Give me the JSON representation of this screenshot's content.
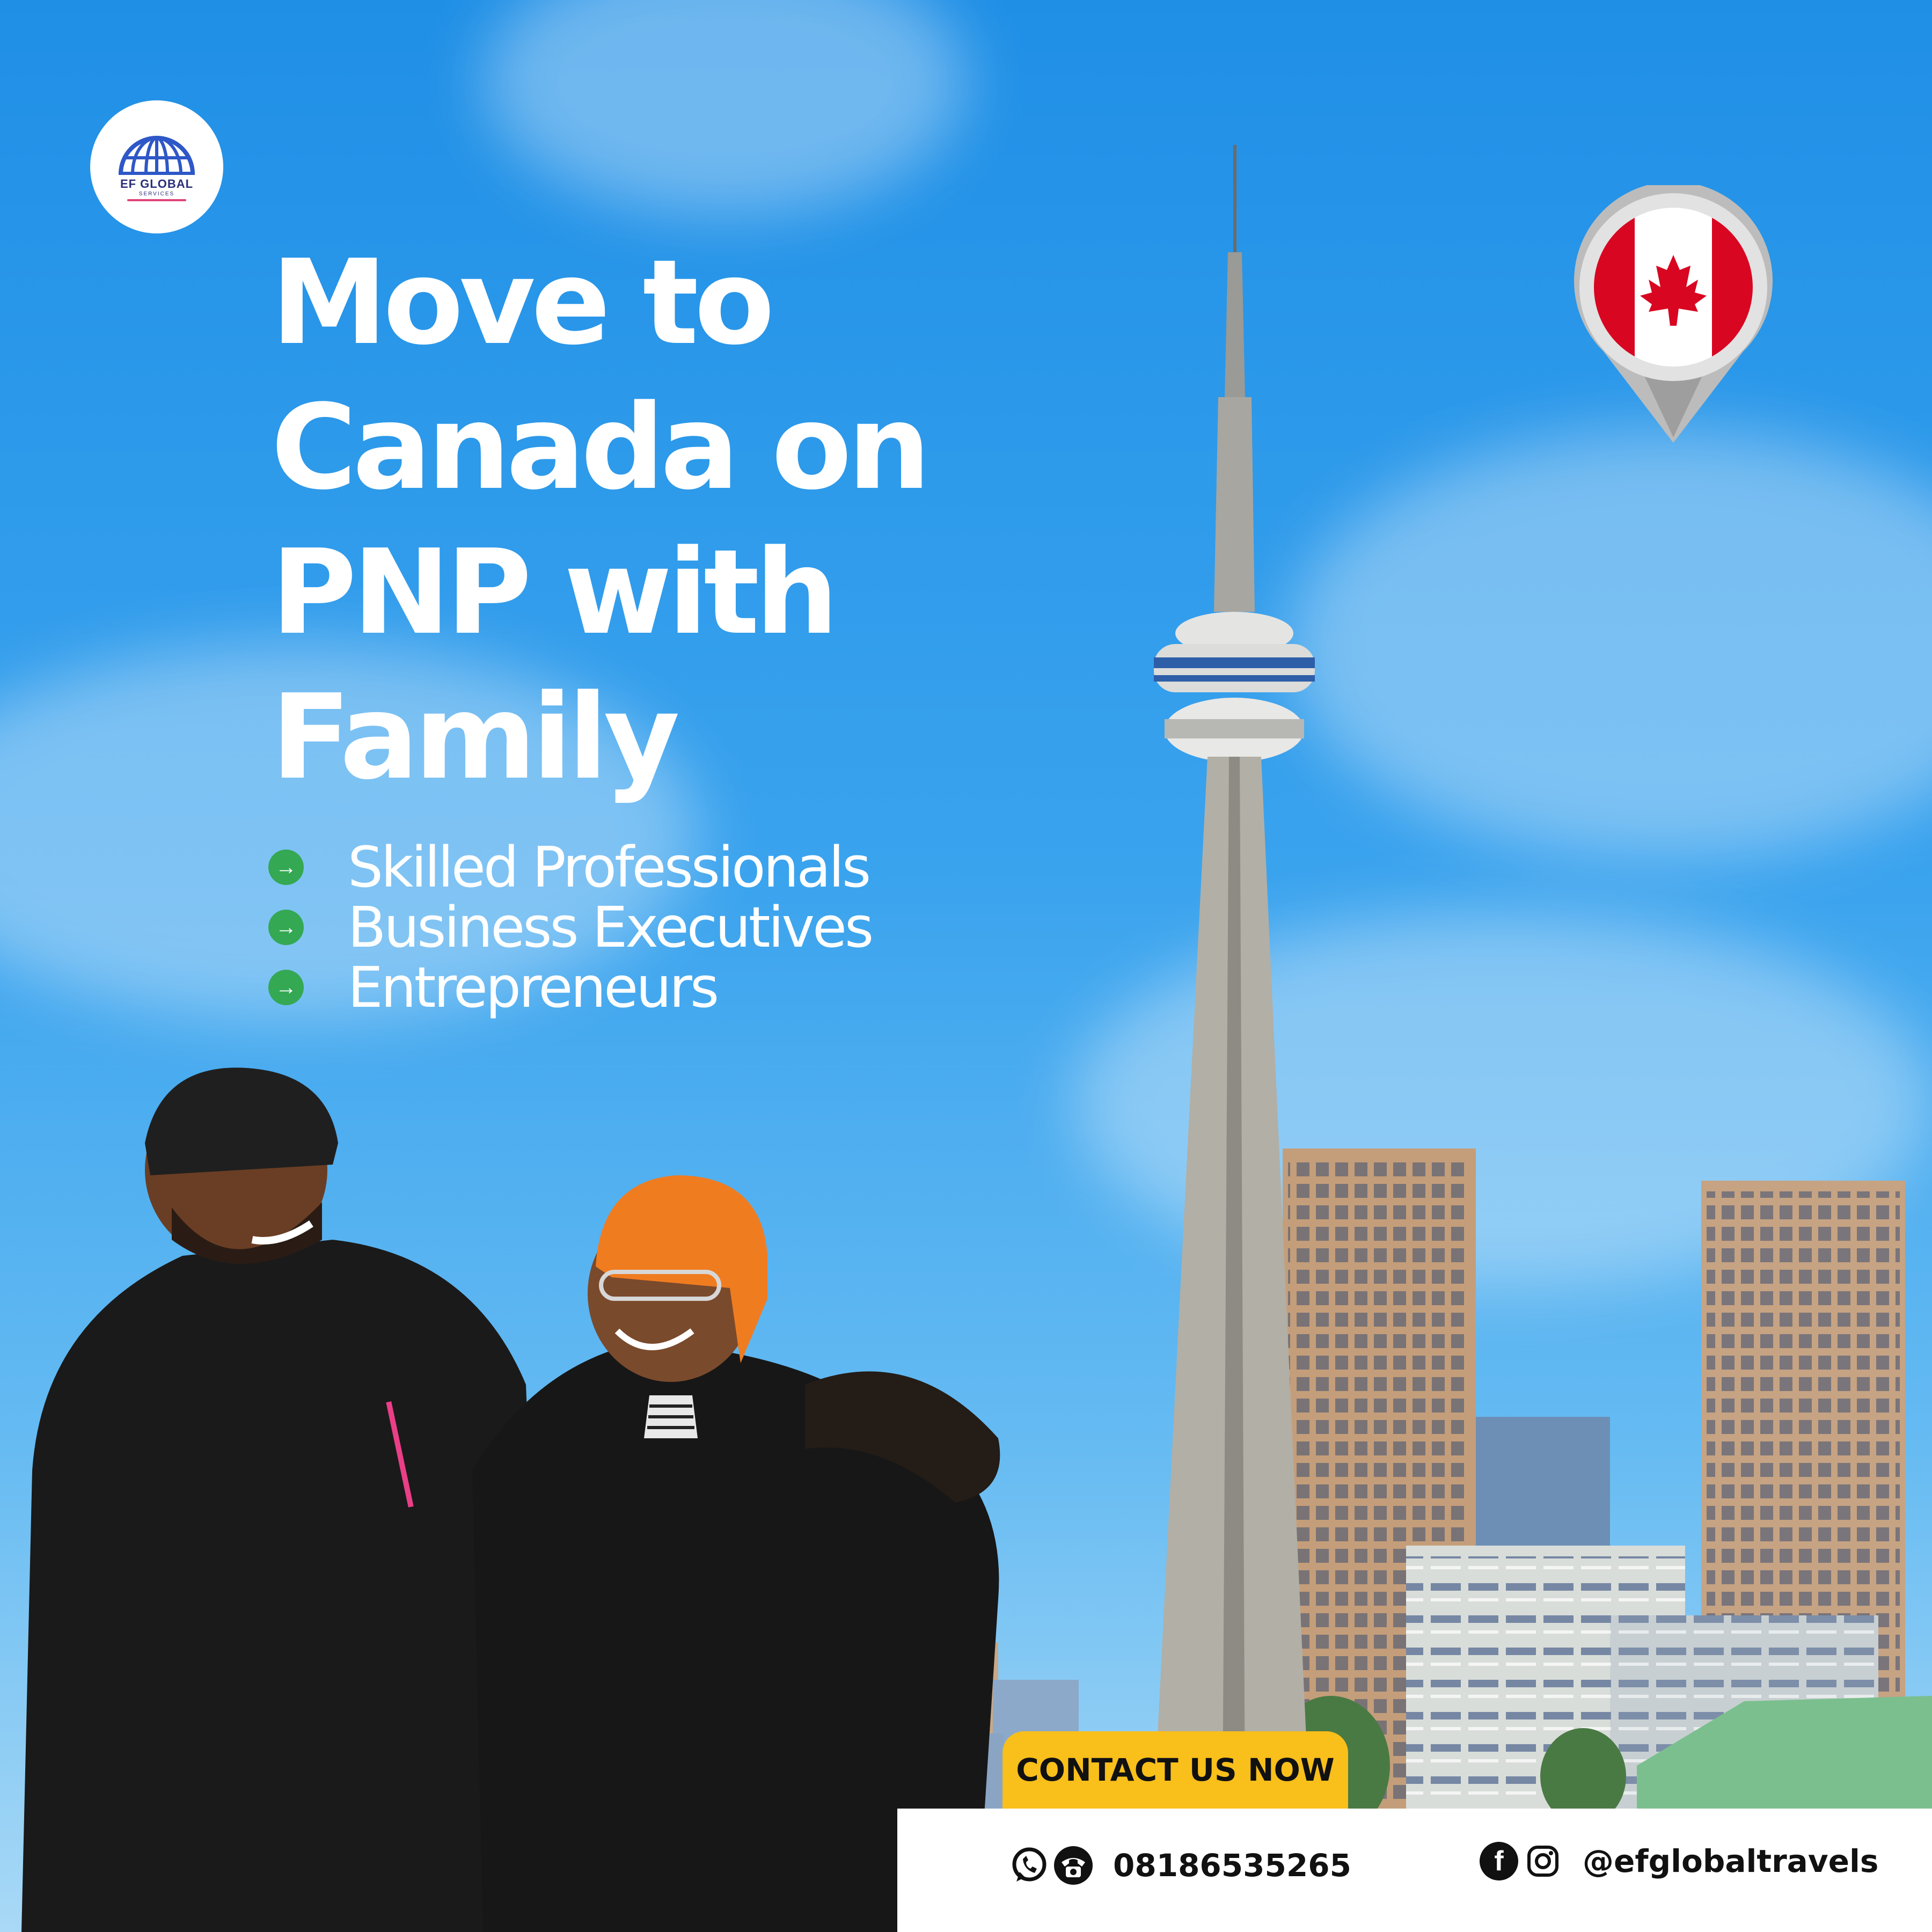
{
  "brand": {
    "name": "EF GLOBAL",
    "sub": "SERVICES"
  },
  "headline": [
    "Move to",
    "Canada on",
    "PNP with",
    "Family"
  ],
  "bullets": [
    {
      "icon": "arrow-right-icon",
      "label": "Skilled Professionals"
    },
    {
      "icon": "arrow-right-icon",
      "label": "Business Executives"
    },
    {
      "icon": "arrow-right-icon",
      "label": "Entrepreneurs"
    }
  ],
  "cta": {
    "label": "CONTACT US NOW"
  },
  "contact": {
    "phone": "08186535265",
    "phone_icons": [
      "whatsapp-icon",
      "telephone-icon"
    ],
    "social_handle": "@efglobaltravels",
    "social_icons": [
      "facebook-icon",
      "instagram-icon"
    ]
  },
  "colors": {
    "sky": "#2a98ea",
    "cta": "#f9bf1a",
    "bullet": "#34a853",
    "flag_red": "#d80621"
  }
}
